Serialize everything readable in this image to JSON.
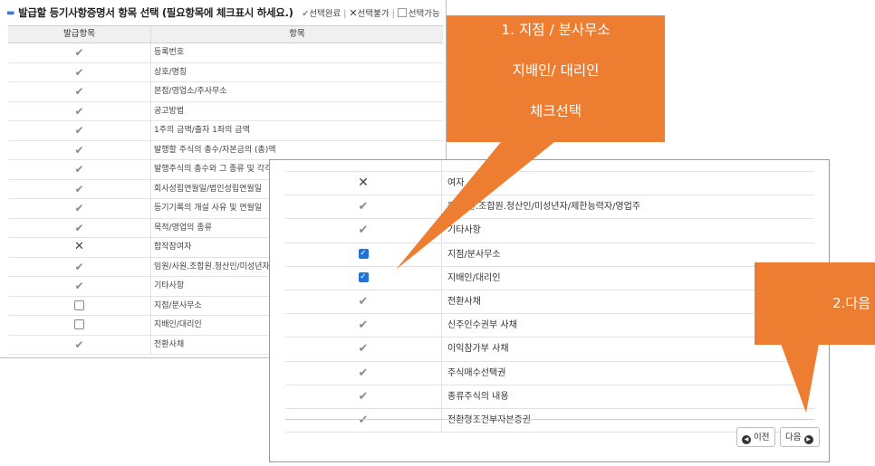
{
  "header": {
    "bullet": "▬",
    "title": "발급할 등기사항증명서 항목 선택 (필요항목에 체크표시 하세요.)",
    "legend_done": "선택완료",
    "legend_unavailable": "선택불가",
    "legend_available": "선택가능",
    "separator": "|"
  },
  "background_table": {
    "columns": [
      "발급항목",
      "항목"
    ],
    "rows": [
      {
        "mark": "check",
        "label": "등록번호"
      },
      {
        "mark": "check",
        "label": "상호/명칭"
      },
      {
        "mark": "check",
        "label": "본점/영업소/주사무소"
      },
      {
        "mark": "check",
        "label": "공고방법"
      },
      {
        "mark": "check",
        "label": "1주의 금액/출자 1좌의 금액"
      },
      {
        "mark": "check",
        "label": "발행할 주식의 총수/자본금의 (총)액"
      },
      {
        "mark": "check",
        "label": "발행주식의 총수와 그 종류 및 각각의 수"
      },
      {
        "mark": "check",
        "label": "회사성립연월일/법인성립연월일"
      },
      {
        "mark": "check",
        "label": "등기기록의 개설 사유 및 연월일"
      },
      {
        "mark": "check",
        "label": "목적/영업의 종류"
      },
      {
        "mark": "x",
        "label": "합작참여자"
      },
      {
        "mark": "check",
        "label": "임원/사원.조합원.청산인/미성년자"
      },
      {
        "mark": "check",
        "label": "기타사항"
      },
      {
        "mark": "box",
        "label": "지점/분사무소"
      },
      {
        "mark": "box",
        "label": "지배인/대리인"
      },
      {
        "mark": "check",
        "label": "전환사채"
      }
    ]
  },
  "dialog_table": {
    "rows": [
      {
        "mark": "check",
        "label": "",
        "partial": true
      },
      {
        "mark": "x",
        "label": "여자"
      },
      {
        "mark": "check",
        "label": "원/사원.조합원.청산인/미성년자/제한능력자/영업주"
      },
      {
        "mark": "check",
        "label": "기타사항"
      },
      {
        "mark": "checked",
        "label": "지점/분사무소"
      },
      {
        "mark": "checked",
        "label": "지배인/대리인"
      },
      {
        "mark": "check",
        "label": "전환사채"
      },
      {
        "mark": "check",
        "label": "신주인수권부 사채"
      },
      {
        "mark": "check",
        "label": "이익참가부 사채"
      },
      {
        "mark": "check",
        "label": "주식매수선택권"
      },
      {
        "mark": "check",
        "label": "종류주식의 내용"
      },
      {
        "mark": "check",
        "label": "전환형조건부자본증권"
      }
    ],
    "prev_label": "이전",
    "next_label": "다음"
  },
  "callouts": {
    "step1_line1": "1.  지점 / 분사무소",
    "step1_line2": "지배인/ 대리인",
    "step1_line3": "체크선택",
    "step2": "2.다음"
  },
  "colors": {
    "callout": "#ed7d31",
    "checkbox_checked": "#1f74d6",
    "check_mark": "#8a8a8a"
  },
  "icons": {
    "check": "✔",
    "x": "✕",
    "prev": "◀",
    "next": "▶"
  }
}
